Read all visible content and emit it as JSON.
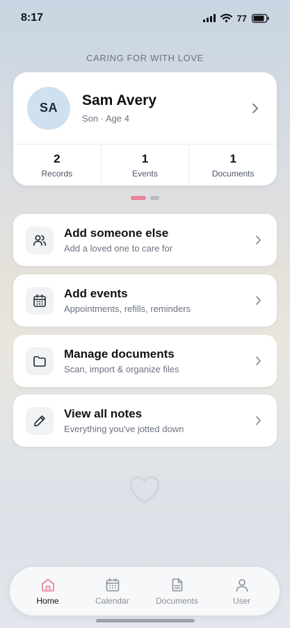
{
  "status": {
    "time": "8:17",
    "battery": "77",
    "icons": [
      "signal-icon",
      "wifi-icon",
      "battery-icon"
    ]
  },
  "caption": "CARING FOR WITH LOVE",
  "profile": {
    "initials": "SA",
    "name": "Sam Avery",
    "subtitle": "Son · Age 4",
    "stats": [
      {
        "value": "2",
        "label": "Records"
      },
      {
        "value": "1",
        "label": "Events"
      },
      {
        "value": "1",
        "label": "Documents"
      }
    ]
  },
  "pager": {
    "active_index": 0,
    "count": 2,
    "active_color": "#e8849c"
  },
  "actions": [
    {
      "icon": "people-icon",
      "title": "Add someone else",
      "subtitle": "Add a loved one to care for"
    },
    {
      "icon": "calendar-icon",
      "title": "Add events",
      "subtitle": "Appointments, refills, reminders"
    },
    {
      "icon": "folder-icon",
      "title": "Manage documents",
      "subtitle": "Scan, import & organize files"
    },
    {
      "icon": "pencil-icon",
      "title": "View all notes",
      "subtitle": "Everything you've jotted down"
    }
  ],
  "tabs": [
    {
      "icon": "home-icon",
      "label": "Home",
      "active": true
    },
    {
      "icon": "calendar-icon",
      "label": "Calendar",
      "active": false
    },
    {
      "icon": "document-icon",
      "label": "Documents",
      "active": false
    },
    {
      "icon": "user-icon",
      "label": "User",
      "active": false
    }
  ],
  "colors": {
    "accent": "#e8849c"
  }
}
